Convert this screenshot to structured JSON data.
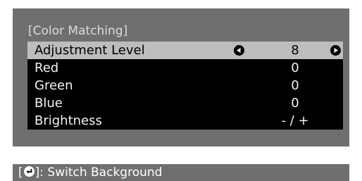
{
  "menu": {
    "title": "[Color Matching]",
    "rows": [
      {
        "label": "Adjustment Level",
        "value": "8",
        "selected": true
      },
      {
        "label": "Red",
        "value": "0"
      },
      {
        "label": "Green",
        "value": "0"
      },
      {
        "label": "Blue",
        "value": "0"
      },
      {
        "label": "Brightness",
        "value": "- / +"
      }
    ],
    "icons": {
      "decrease": "left-arrow-circle-icon",
      "increase": "right-arrow-circle-icon"
    }
  },
  "footer": {
    "bracket_open": "[",
    "bracket_close": "]",
    "icon": "enter-icon",
    "text": ": Switch Background"
  },
  "colors": {
    "panel_bg": "#6f6f6f",
    "row_bg": "#000000",
    "selected_bg": "#bdbdbd",
    "text_light": "#f2f2f2",
    "title_text": "#dcdcdc"
  }
}
